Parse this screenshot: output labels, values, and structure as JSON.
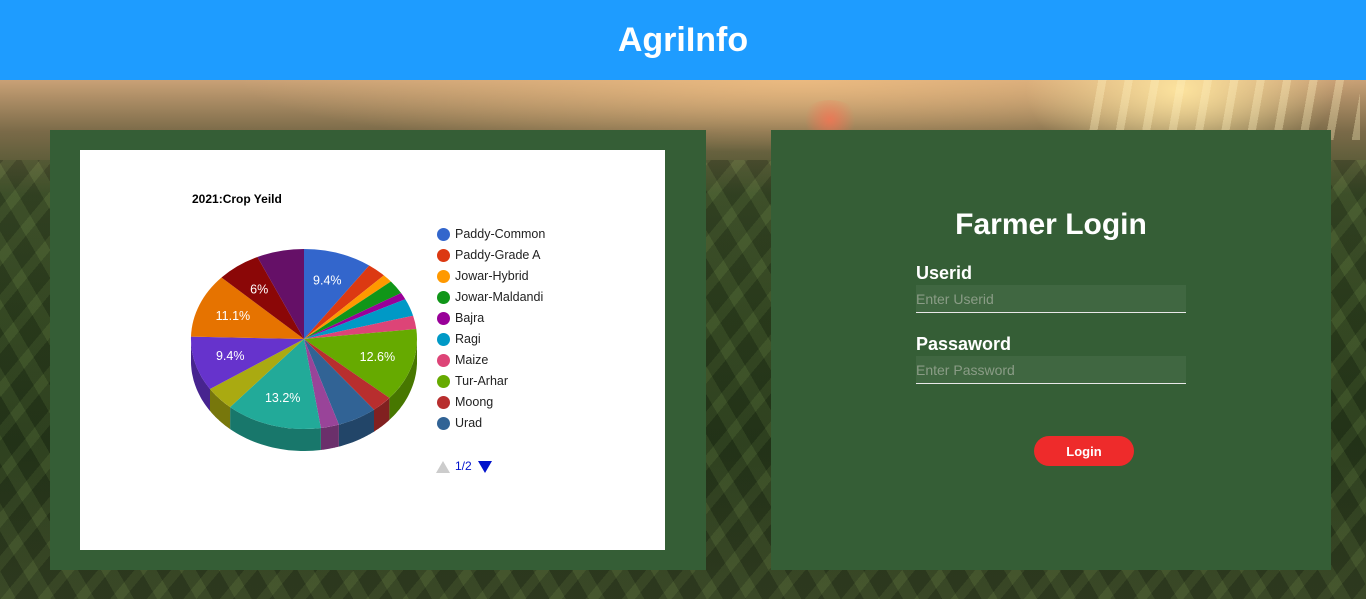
{
  "app": {
    "title": "AgriInfo"
  },
  "colors": {
    "header": "#1e9cff",
    "panel": "#355e36",
    "login_button": "#ee2b2b"
  },
  "chart_data": {
    "type": "pie",
    "title": "2021:Crop Yeild",
    "slices": [
      {
        "name": "Paddy-Common",
        "value": 9.4,
        "label": "9.4%",
        "color": "#3366cc"
      },
      {
        "name": "Paddy-Grade A",
        "value": 2.6,
        "label": "",
        "color": "#dc3912"
      },
      {
        "name": "Jowar-Hybrid",
        "value": 1.4,
        "label": "",
        "color": "#ff9900"
      },
      {
        "name": "Jowar-Maldandi",
        "value": 2.4,
        "label": "",
        "color": "#109618"
      },
      {
        "name": "Bajra",
        "value": 1.2,
        "label": "",
        "color": "#990099"
      },
      {
        "name": "Ragi",
        "value": 3.0,
        "label": "",
        "color": "#0099c6"
      },
      {
        "name": "Maize",
        "value": 2.3,
        "label": "",
        "color": "#dd4477"
      },
      {
        "name": "Tur-Arhar",
        "value": 12.6,
        "label": "12.6%",
        "color": "#66aa00"
      },
      {
        "name": "Moong",
        "value": 2.9,
        "label": "",
        "color": "#b82e2e"
      },
      {
        "name": "Urad",
        "value": 5.4,
        "label": "",
        "color": "#316395"
      },
      {
        "name": "",
        "value": 2.5,
        "label": "",
        "color": "#994499"
      },
      {
        "name": "",
        "value": 13.2,
        "label": "13.2%",
        "color": "#22aa99"
      },
      {
        "name": "",
        "value": 4.1,
        "label": "",
        "color": "#aaaa11"
      },
      {
        "name": "",
        "value": 9.4,
        "label": "9.4%",
        "color": "#6633cc"
      },
      {
        "name": "",
        "value": 11.1,
        "label": "11.1%",
        "color": "#e67300"
      },
      {
        "name": "",
        "value": 6.0,
        "label": "6%",
        "color": "#8b0707"
      },
      {
        "name": "",
        "value": 6.5,
        "label": "",
        "color": "#651067"
      }
    ],
    "pagination": "1/2"
  },
  "login": {
    "title": "Farmer Login",
    "userid_label": "Userid",
    "userid_placeholder": "Enter Userid",
    "password_label": "Passaword",
    "password_placeholder": "Enter Password",
    "button_label": "Login"
  }
}
